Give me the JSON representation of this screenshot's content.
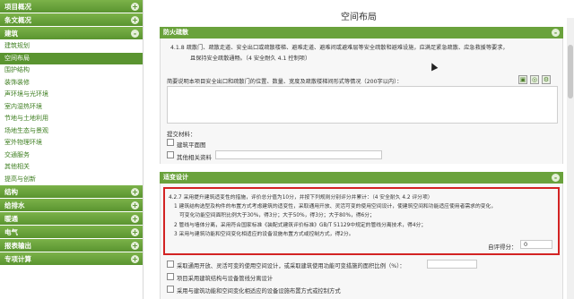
{
  "sidebar": {
    "groups": [
      {
        "label": "项目概况",
        "toggle": "+"
      },
      {
        "label": "条文概况",
        "toggle": "+"
      },
      {
        "label": "建筑",
        "toggle": "-"
      }
    ],
    "items": [
      "建筑规划",
      "空间布局",
      "围护结构",
      "装饰装修",
      "声环境与光环境",
      "室内湿热环境",
      "节地与土地利用",
      "场地生态与景观",
      "室外物理环境",
      "交通服务",
      "其他相关",
      "提高与创新"
    ],
    "active_index": 1,
    "groups_bottom": [
      {
        "label": "结构",
        "toggle": "+"
      },
      {
        "label": "给排水",
        "toggle": "+"
      },
      {
        "label": "暖通",
        "toggle": "+"
      },
      {
        "label": "电气",
        "toggle": "+"
      },
      {
        "label": "报表输出",
        "toggle": "+"
      },
      {
        "label": "专项计算",
        "toggle": "+"
      }
    ]
  },
  "main": {
    "title": "空间布局",
    "section1": {
      "header": "防火疏散",
      "toggle": "-",
      "clause_line1": "4.1.8 疏散门、疏散走道、安全出口或疏散楼梯、避难走道、避难间或避难层等安全疏散和避难设施，应满足紧急疏散、应急救援等要求，",
      "clause_line2": "且保持安全疏散通畅。（4 安全耐久 4.1 控制项）",
      "desc": "简要说明本项目安全出口和疏散门的位置、数量、宽度及疏散楼梯间形式等情况（200字以内）：",
      "materials_label": "提交材料：",
      "check1": "建筑平面图",
      "check2": "其他相关资料"
    },
    "section2": {
      "header": "适变设计",
      "toggle": "-",
      "line1": "4.2.7 采用提升建筑适变性的措施，评价总分值为10分，并按下列规则分别评分并累计：（4 安全耐久    4.2 评分项）",
      "line2": "1 建筑结构选型及构件的布置方式考虑建筑的适变性，采取通用开放、灵活可变的使用空间设计，使建筑空间和功能适应使用者需求的变化，",
      "line3": "可变化功能空间面积比例大于30%，得3分；大于50%，得3分；大于80%，得6分；",
      "line4": "2 管线与墙体分离，采用符合国家标准《装配式建筑评价标准》GB/T 51129中规定的管线分离技术，得4分；",
      "line5": "3 采用与建筑功能和空间变化相适应的设备设施布置方式或控制方式，得2分。",
      "score_label": "自评得分：",
      "score_value": "0",
      "opt1": "采取通用开放、灵活可变的使用空间设计，或采取建筑使用功能可变措施的面积比例（%）：",
      "opt2": "项目采用建筑结构与设备管线分离设计",
      "opt3": "采用与建筑功能和空间变化相适应的设备设施布置方式或控制方式"
    }
  }
}
